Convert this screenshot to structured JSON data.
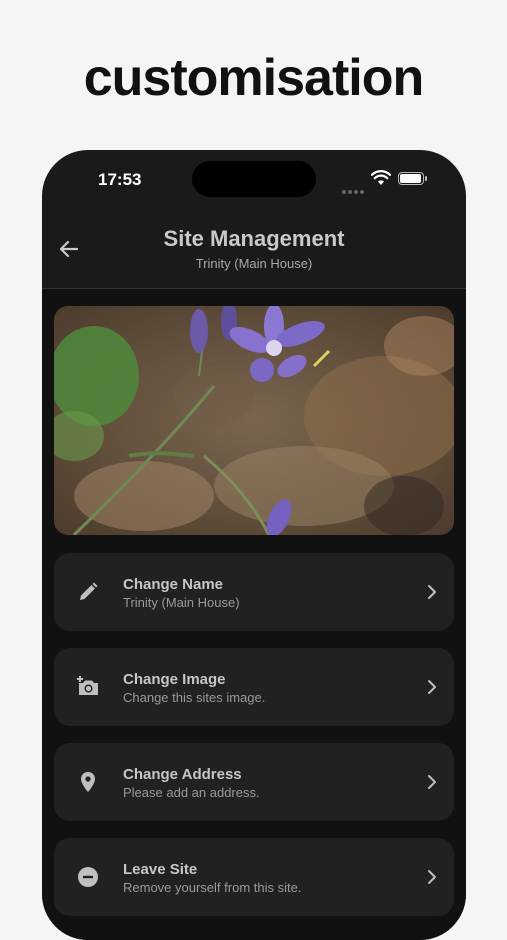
{
  "headline": "customisation",
  "status": {
    "time": "17:53"
  },
  "nav": {
    "title": "Site Management",
    "subtitle": "Trinity (Main House)"
  },
  "site_image": {
    "description_icon": "site-photo"
  },
  "menu": [
    {
      "label": "Change Name",
      "description": "Trinity (Main House)",
      "icon": "pencil-icon"
    },
    {
      "label": "Change Image",
      "description": "Change this sites image.",
      "icon": "add-photo-icon"
    },
    {
      "label": "Change Address",
      "description": "Please add an address.",
      "icon": "location-pin-icon"
    },
    {
      "label": "Leave Site",
      "description": "Remove yourself from this site.",
      "icon": "remove-circle-icon"
    }
  ],
  "colors": {
    "surface": "#1a1a1a",
    "card": "#212121",
    "text": "#c6c6c6",
    "subtext": "#9a9a9a"
  }
}
